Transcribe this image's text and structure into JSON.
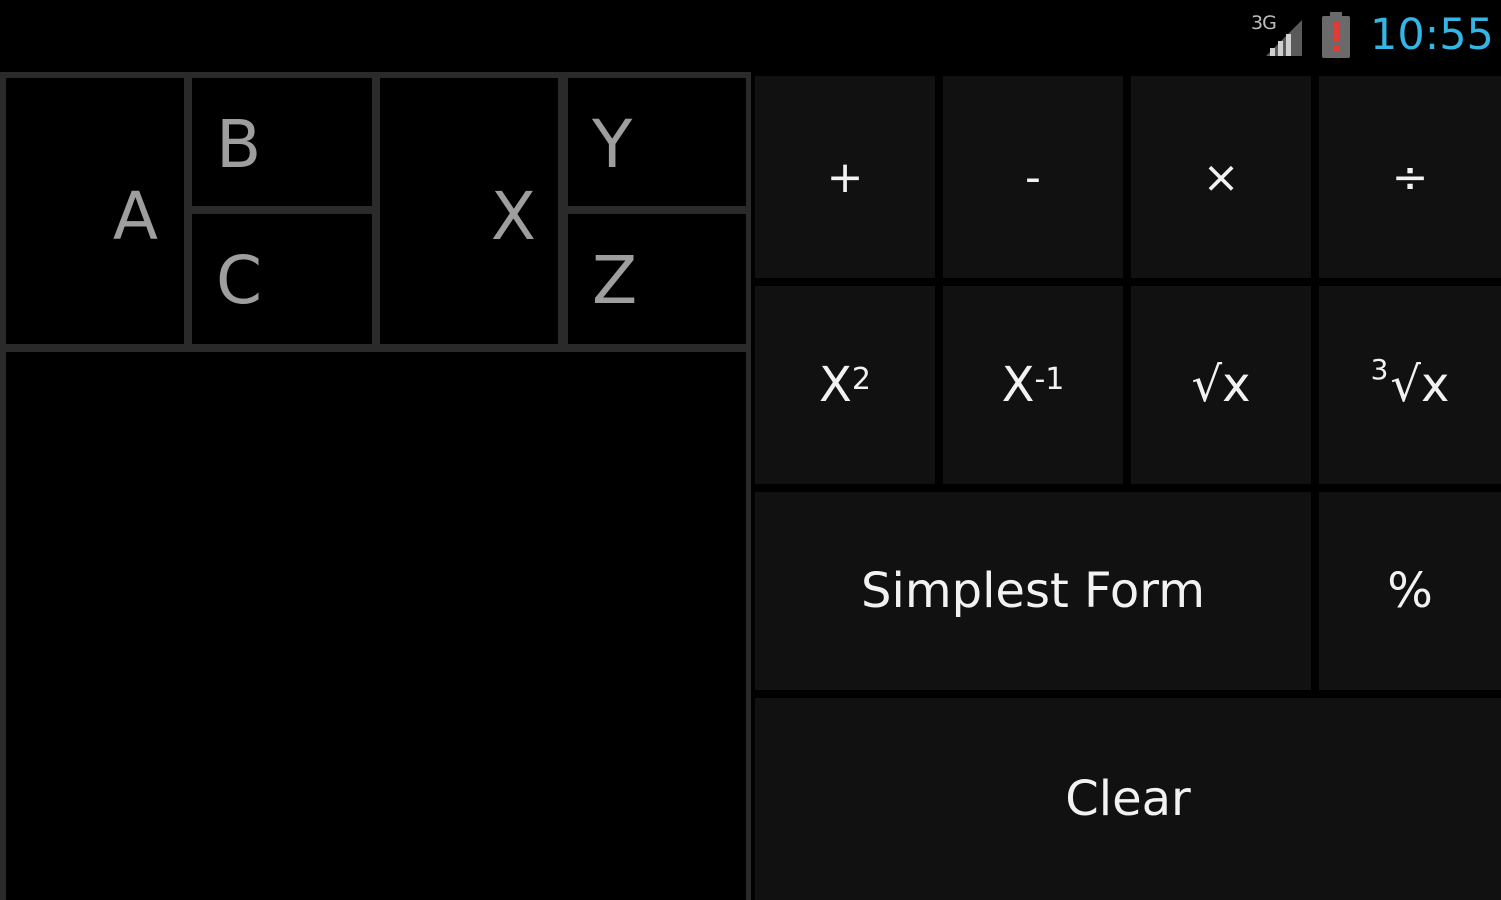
{
  "status_bar": {
    "network": "3G",
    "signal_icon": "signal-bars-icon",
    "battery_icon": "battery-low-icon",
    "time": "10:55",
    "time_color": "#33b5e5"
  },
  "inputs": {
    "a": "A",
    "b": "B",
    "c": "C",
    "x": "X",
    "y": "Y",
    "z": "Z",
    "result": ""
  },
  "keypad": {
    "plus": "+",
    "minus": "-",
    "times": "×",
    "divide": "÷",
    "square_base": "X",
    "square_sup": "2",
    "inverse_base": "X",
    "inverse_sup": "-1",
    "sqrt": "√x",
    "cbrt_pre": "3",
    "cbrt": "√x",
    "simplest_form": "Simplest Form",
    "percent": "%",
    "clear": "Clear"
  }
}
